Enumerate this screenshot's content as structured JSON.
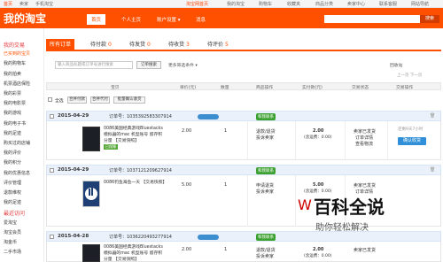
{
  "topbar": {
    "items": [
      "首页",
      "卖家",
      "手机淘宝"
    ],
    "right": [
      "淘宝网首页",
      "我的淘宝",
      "购物车",
      "收藏夹",
      "商品分类",
      "卖家中心",
      "联系客服",
      "网站导航"
    ]
  },
  "header": {
    "logo": "我的淘宝",
    "nav": [
      "首页",
      "个人主页",
      "账户设置",
      "消息"
    ],
    "search_button": "搜索"
  },
  "sidebar": {
    "items": [
      {
        "label": "我的交易",
        "type": "head"
      },
      {
        "label": "已买到的宝贝",
        "type": "active"
      },
      {
        "label": "我的购物车",
        "type": "normal"
      },
      {
        "label": "我的拍卖",
        "type": "normal"
      },
      {
        "label": "机票酒店保险",
        "type": "normal"
      },
      {
        "label": "我的彩票",
        "type": "normal"
      },
      {
        "label": "我的电影票",
        "type": "normal"
      },
      {
        "label": "我的游戏",
        "type": "normal"
      },
      {
        "label": "我的电子书",
        "type": "normal"
      },
      {
        "label": "我的足迹",
        "type": "normal"
      },
      {
        "label": "购买过的店铺",
        "type": "normal"
      },
      {
        "label": "我的评价",
        "type": "normal"
      },
      {
        "label": "我的积分",
        "type": "normal"
      },
      {
        "label": "我的优惠信息",
        "type": "normal"
      },
      {
        "label": "评价管理",
        "type": "normal"
      },
      {
        "label": "退款维权",
        "type": "normal"
      },
      {
        "label": "我的足迹",
        "type": "normal"
      },
      {
        "label": "最近访问",
        "type": "head"
      },
      {
        "label": "爱淘宝",
        "type": "normal"
      },
      {
        "label": "淘宝会员",
        "type": "normal"
      },
      {
        "label": "淘金币",
        "type": "normal"
      },
      {
        "label": "二手市场",
        "type": "normal"
      }
    ]
  },
  "tabs": [
    {
      "label": "所有订单",
      "count": ""
    },
    {
      "label": "待付款",
      "count": "0"
    },
    {
      "label": "待发货",
      "count": "0"
    },
    {
      "label": "待收货",
      "count": "3"
    },
    {
      "label": "待评价",
      "count": "5"
    }
  ],
  "filter": {
    "search_placeholder": "输入商品标题或订单号进行搜索",
    "search_button": "订单搜索",
    "more": "更多筛选条件",
    "recycle": "回收站",
    "pager": "上一页 下一页"
  },
  "columns": [
    "宝贝",
    "单价(元)",
    "数量",
    "商品操作",
    "实付款(元)",
    "交易状态",
    "交易操作"
  ],
  "bulk": {
    "select_all": "全选",
    "merge_pay": "合并付款",
    "merge_delivery": "合并代付",
    "batch_confirm": "批量确认收货"
  },
  "orders": [
    {
      "date": "2015-04-29",
      "order_no": "订单号：1035392583307914",
      "contact": "和我联系",
      "title": "0086美国经典游戏Bluestacks模拟器的mac 机型账号 留存积分量 【交易快照】",
      "tag": "已保障",
      "price": "2.00",
      "qty": "1",
      "ops": [
        "退款/退货",
        "投诉卖家"
      ],
      "paid": "2.00",
      "shipping": "(含运费：0.00)",
      "status": [
        "卖家已发货",
        "订单详情",
        "查看物流"
      ],
      "action": "确认收货",
      "extra": "还剩9天7小时"
    },
    {
      "date": "2015-04-29",
      "order_no": "订单号：1037121209627914",
      "contact": "和我联系",
      "title": "0086钓鱼海鱼一天 【交易快照】",
      "tag": "",
      "price": "5.00",
      "qty": "1",
      "ops": [
        "申请退货",
        "投诉卖家"
      ],
      "paid": "5.00",
      "shipping": "(含运费：0.00)",
      "status": [
        "卖家已发货",
        "订单详情"
      ],
      "action": "确认收货",
      "extra": ""
    },
    {
      "date": "2015-04-28",
      "order_no": "订单号：1036220493277914",
      "contact": "和我联系",
      "title": "0086美国经典游戏Bluestacks模拟器的mac 机型账号 留存积分量 【交易快照】",
      "tag": "",
      "price": "2.00",
      "qty": "1",
      "ops": [
        "退款/退货",
        "投诉卖家"
      ],
      "paid": "2.00",
      "shipping": "(含运费：0.00)",
      "status": [
        "卖家已发货"
      ],
      "action": "",
      "extra": ""
    }
  ],
  "watermark": {
    "title": "百科全说",
    "subtitle": "助你轻松解决"
  }
}
